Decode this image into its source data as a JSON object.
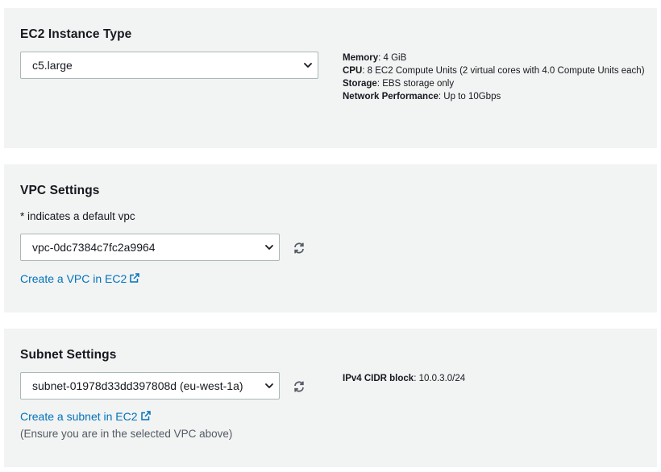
{
  "ec2": {
    "title": "EC2 Instance Type",
    "selected": "c5.large",
    "memory_label": "Memory",
    "memory_value": ": 4 GiB",
    "cpu_label": "CPU",
    "cpu_value": ": 8 EC2 Compute Units (2 virtual cores with 4.0 Compute Units each)",
    "storage_label": "Storage",
    "storage_value": ": EBS storage only",
    "network_label": "Network Performance",
    "network_value": ": Up to 10Gbps"
  },
  "vpc": {
    "title": "VPC Settings",
    "hint": "* indicates a default vpc",
    "selected": "vpc-0dc7384c7fc2a9964",
    "create_link": "Create a VPC in EC2"
  },
  "subnet": {
    "title": "Subnet Settings",
    "selected": "subnet-01978d33dd397808d (eu-west-1a)",
    "cidr_label": "IPv4 CIDR block",
    "cidr_value": ": 10.0.3.0/24",
    "create_link": "Create a subnet in EC2",
    "note": "(Ensure you are in the selected VPC above)"
  },
  "colors": {
    "panel_bg": "#f2f3f3",
    "link": "#0073bb",
    "border": "#aab7b8",
    "text": "#16191f"
  },
  "icons": [
    "chevron-down-icon",
    "refresh-icon",
    "external-link-icon"
  ]
}
